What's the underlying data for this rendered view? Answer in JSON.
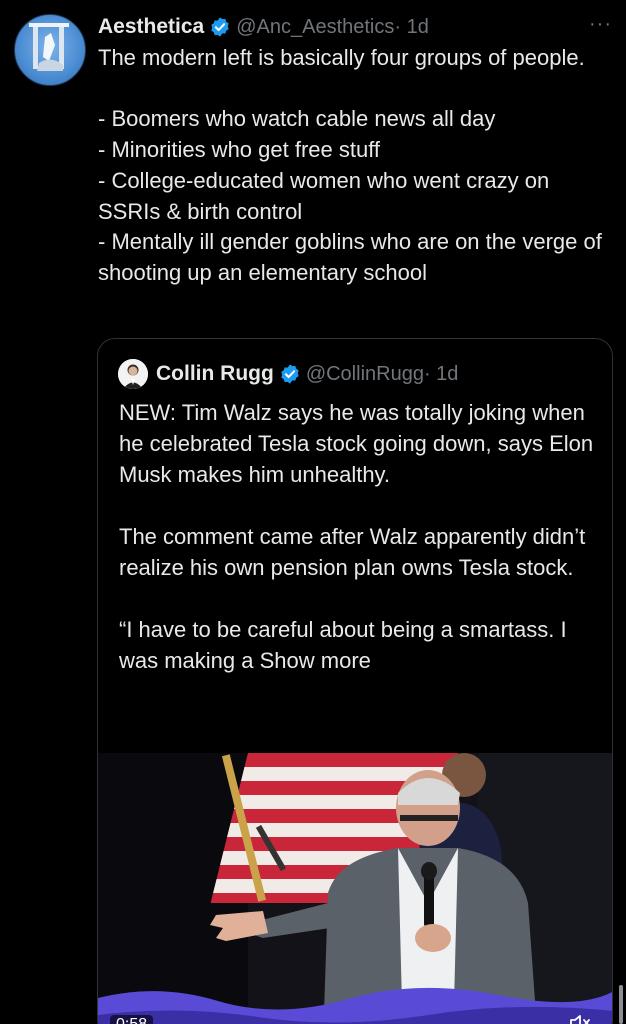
{
  "tweet": {
    "author_name": "Aesthetica",
    "handle": "@Anc_Aesthetics",
    "time": "· 1d",
    "more": "···",
    "text": "The modern left is basically four groups of people.\n\n- Boomers who watch cable news all day\n- Minorities who get free stuff\n- College-educated women who went crazy on SSRIs & birth control\n- Mentally ill gender goblins who are on the verge of shooting up an elementary school"
  },
  "quote": {
    "author_name": "Collin Rugg",
    "handle": "@CollinRugg",
    "time": "· 1d",
    "text": "NEW: Tim Walz says he was totally joking when he celebrated Tesla stock going down, says Elon Musk makes him unhealthy.\n\nThe comment came after Walz apparently didn’t realize his own pension plan owns Tesla stock.\n\n“I have to be careful about being a smartass. I was making a ",
    "show_more": "Show more",
    "video_time": "0:58"
  },
  "colors": {
    "background": "#000000",
    "text": "#e7e9ea",
    "secondary": "#71767b",
    "verified": "#1d9bf0",
    "border": "#2f3336"
  },
  "icons": [
    "verified-badge-icon",
    "more-icon",
    "mute-icon"
  ]
}
